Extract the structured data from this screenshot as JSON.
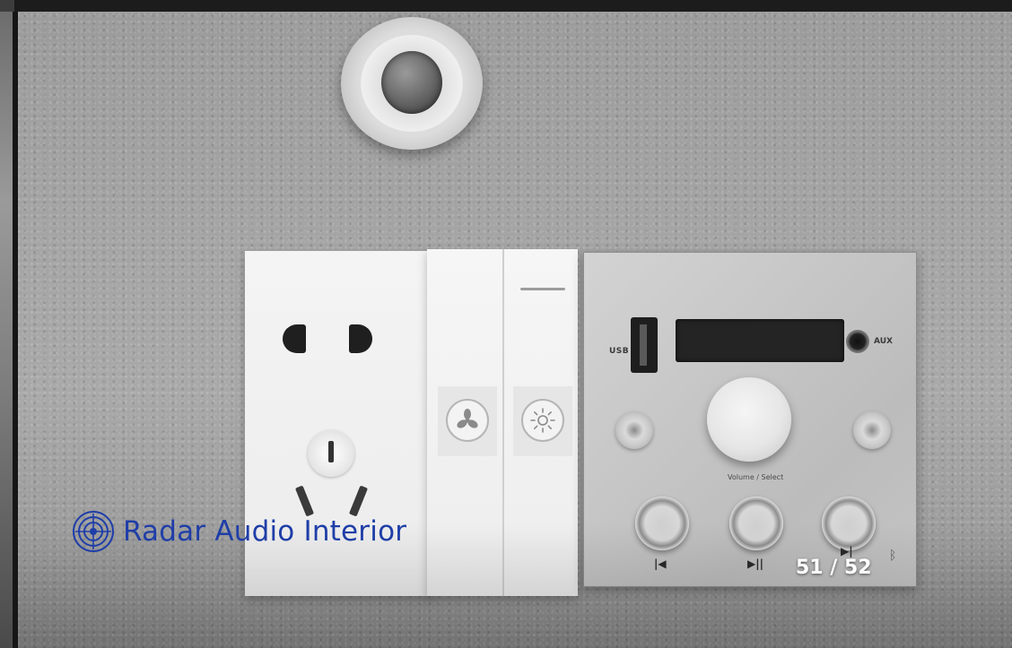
{
  "viewer": {
    "brand_name": "Radar Audio Interior",
    "brand_color": "#1f3ea8",
    "brand_logo_icon": "radar-target-icon",
    "page_counter": "51 / 52",
    "current_page": 51,
    "total_pages": 52
  },
  "slide_photo": {
    "panels": {
      "audio": {
        "usb_label": "USB",
        "aux_label": "AUX",
        "knob_label": "Volume / Select",
        "control_icons": [
          "previous-track-icon",
          "play-pause-icon",
          "next-track-icon",
          "bluetooth-icon"
        ]
      },
      "switch": {
        "icons": [
          "fan-icon",
          "light-icon"
        ]
      }
    }
  }
}
